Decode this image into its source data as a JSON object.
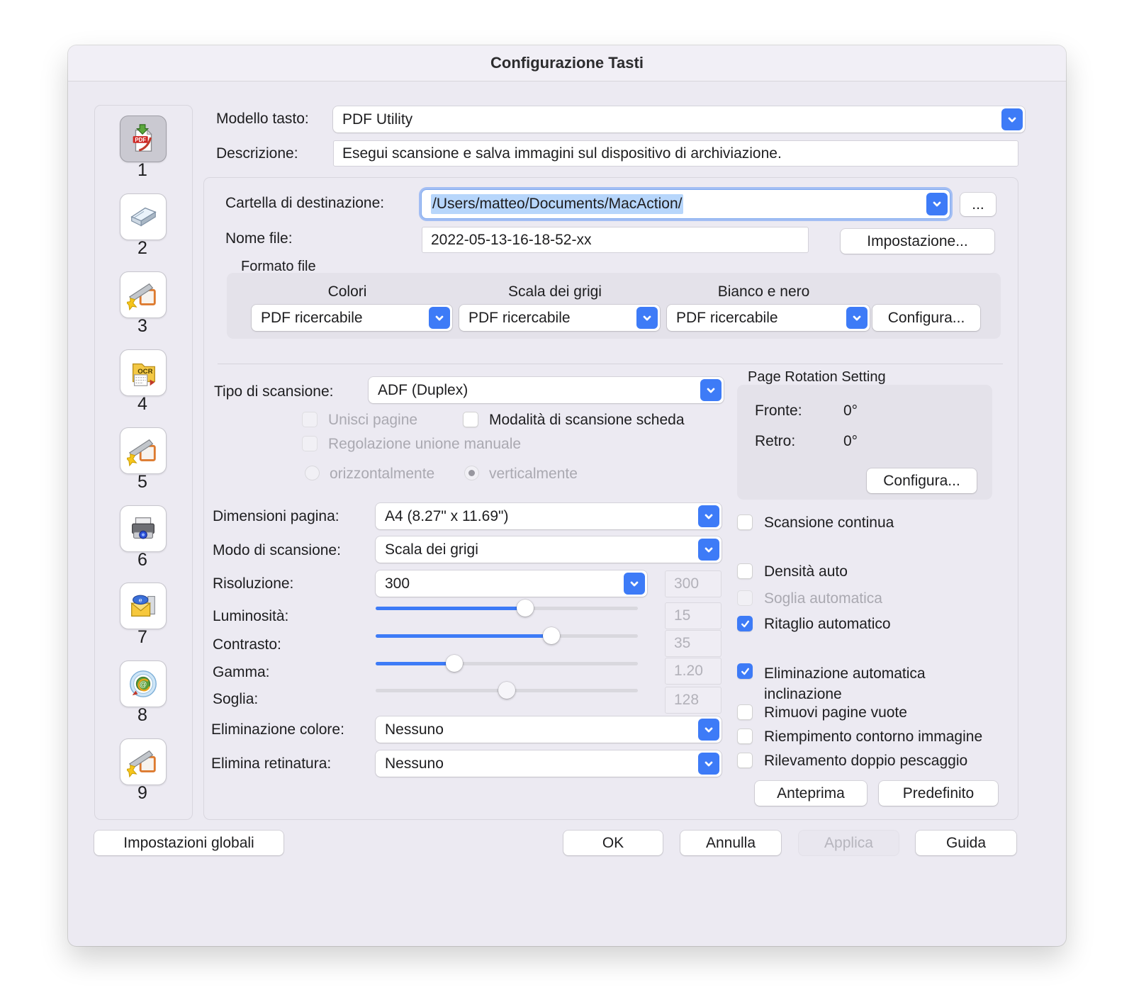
{
  "window": {
    "title": "Configurazione Tasti"
  },
  "colors": {
    "accent": "#3d7bf7",
    "window_bg": "#eceaf2",
    "selection": "#b7d6fb"
  },
  "icons": [
    "pdf-save-icon",
    "scanner-icon",
    "scan-app-icon",
    "ocr-folder-icon",
    "scan-app-icon",
    "printer-icon",
    "mail-icon",
    "web-at-icon",
    "scan-app-icon",
    "chevron-down-icon",
    "check-icon"
  ],
  "sidebar": {
    "items": [
      {
        "number": "1",
        "icon": "pdf-save-icon",
        "selected": true
      },
      {
        "number": "2",
        "icon": "scanner-icon"
      },
      {
        "number": "3",
        "icon": "scan-app-icon"
      },
      {
        "number": "4",
        "icon": "ocr-folder-icon"
      },
      {
        "number": "5",
        "icon": "scan-app-icon"
      },
      {
        "number": "6",
        "icon": "printer-icon"
      },
      {
        "number": "7",
        "icon": "mail-icon"
      },
      {
        "number": "8",
        "icon": "web-at-icon"
      },
      {
        "number": "9",
        "icon": "scan-app-icon"
      }
    ]
  },
  "fields": {
    "model_label": "Modello tasto:",
    "model_value": "PDF Utility",
    "description_label": "Descrizione:",
    "description_value": "Esegui scansione e salva immagini sul dispositivo di archiviazione.",
    "dest_label": "Cartella di destinazione:",
    "dest_value": "/Users/matteo/Documents/MacAction/",
    "browse_button": "...",
    "filename_label": "Nome file:",
    "filename_value": "2022-05-13-16-18-52-xx",
    "setting_button": "Impostazione..."
  },
  "format": {
    "group_label": "Formato file",
    "columns": [
      {
        "header": "Colori",
        "value": "PDF ricercabile"
      },
      {
        "header": "Scala dei grigi",
        "value": "PDF ricercabile"
      },
      {
        "header": "Bianco e nero",
        "value": "PDF ricercabile"
      }
    ],
    "configure_button": "Configura..."
  },
  "scan": {
    "type_label": "Tipo di scansione:",
    "type_value": "ADF (Duplex)",
    "merge_pages_label": "Unisci pagine",
    "card_mode_label": "Modalità di scansione scheda",
    "manual_merge_label": "Regolazione unione manuale",
    "horizontal_label": "orizzontalmente",
    "vertical_label": "verticalmente"
  },
  "rotation": {
    "group_label": "Page Rotation Setting",
    "front_label": "Fronte:",
    "front_value": "0°",
    "back_label": "Retro:",
    "back_value": "0°",
    "configure_button": "Configura..."
  },
  "params": {
    "page_size_label": "Dimensioni pagina:",
    "page_size_value": "A4 (8.27\" x 11.69\")",
    "mode_label": "Modo di scansione:",
    "mode_value": "Scala dei grigi",
    "resolution_label": "Risoluzione:",
    "resolution_value": "300",
    "resolution_box_value": "300",
    "sliders": [
      {
        "label": "Luminosità:",
        "value": "15"
      },
      {
        "label": "Contrasto:",
        "value": "35"
      },
      {
        "label": "Gamma:",
        "value": "1.20"
      },
      {
        "label": "Soglia:",
        "value": "128"
      }
    ],
    "color_dropout_label": "Eliminazione colore:",
    "color_dropout_value": "Nessuno",
    "descreen_label": "Elimina retinatura:",
    "descreen_value": "Nessuno"
  },
  "options": {
    "continuous_label": "Scansione continua",
    "auto_density_label": "Densità auto",
    "auto_threshold_label": "Soglia automatica",
    "auto_crop_label": "Ritaglio automatico",
    "deskew_label": "Eliminazione automatica inclinazione",
    "remove_blank_label": "Rimuovi pagine vuote",
    "edge_fill_label": "Riempimento contorno immagine",
    "double_feed_label": "Rilevamento doppio pescaggio",
    "preview_button": "Anteprima",
    "default_button": "Predefinito"
  },
  "footer": {
    "global_button": "Impostazioni globali",
    "ok_button": "OK",
    "cancel_button": "Annulla",
    "apply_button": "Applica",
    "help_button": "Guida"
  }
}
